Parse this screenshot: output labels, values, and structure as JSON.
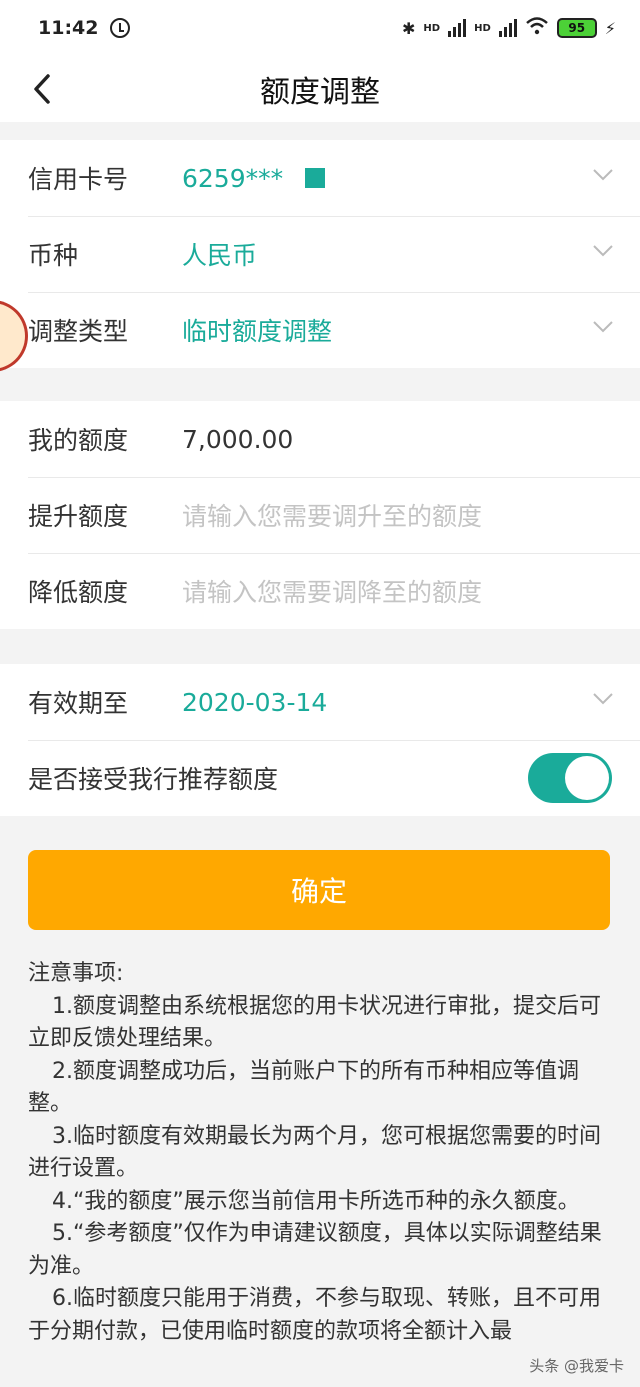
{
  "status": {
    "time": "11:42",
    "battery": "95",
    "hd1": "HD",
    "hd2": "HD"
  },
  "nav": {
    "title": "额度调整"
  },
  "card_info": {
    "card_number_label": "信用卡号",
    "card_number_value": "6259***",
    "currency_label": "币种",
    "currency_value": "人民币",
    "adjust_type_label": "调整类型",
    "adjust_type_value": "临时额度调整"
  },
  "limits": {
    "my_limit_label": "我的额度",
    "my_limit_value": "7,000.00",
    "raise_label": "提升额度",
    "raise_placeholder": "请输入您需要调升至的额度",
    "lower_label": "降低额度",
    "lower_placeholder": "请输入您需要调降至的额度"
  },
  "validity": {
    "valid_until_label": "有效期至",
    "valid_until_value": "2020-03-14",
    "accept_recommend_label": "是否接受我行推荐额度",
    "accept_recommend_on": true
  },
  "confirm_label": "确定",
  "notes": {
    "title": "注意事项:",
    "items": [
      "1.额度调整由系统根据您的用卡状况进行审批，提交后可立即反馈处理结果。",
      "2.额度调整成功后，当前账户下的所有币种相应等值调整。",
      "3.临时额度有效期最长为两个月，您可根据您需要的时间进行设置。",
      "4.“我的额度”展示您当前信用卡所选币种的永久额度。",
      "5.“参考额度”仅作为申请建议额度，具体以实际调整结果为准。",
      "6.临时额度只能用于消费，不参与取现、转账，且不可用于分期付款，已使用临时额度的款项将全额计入最"
    ]
  },
  "watermark": "头条 @我爱卡",
  "colors": {
    "accent": "#1aab9a",
    "button": "#ffa800"
  }
}
